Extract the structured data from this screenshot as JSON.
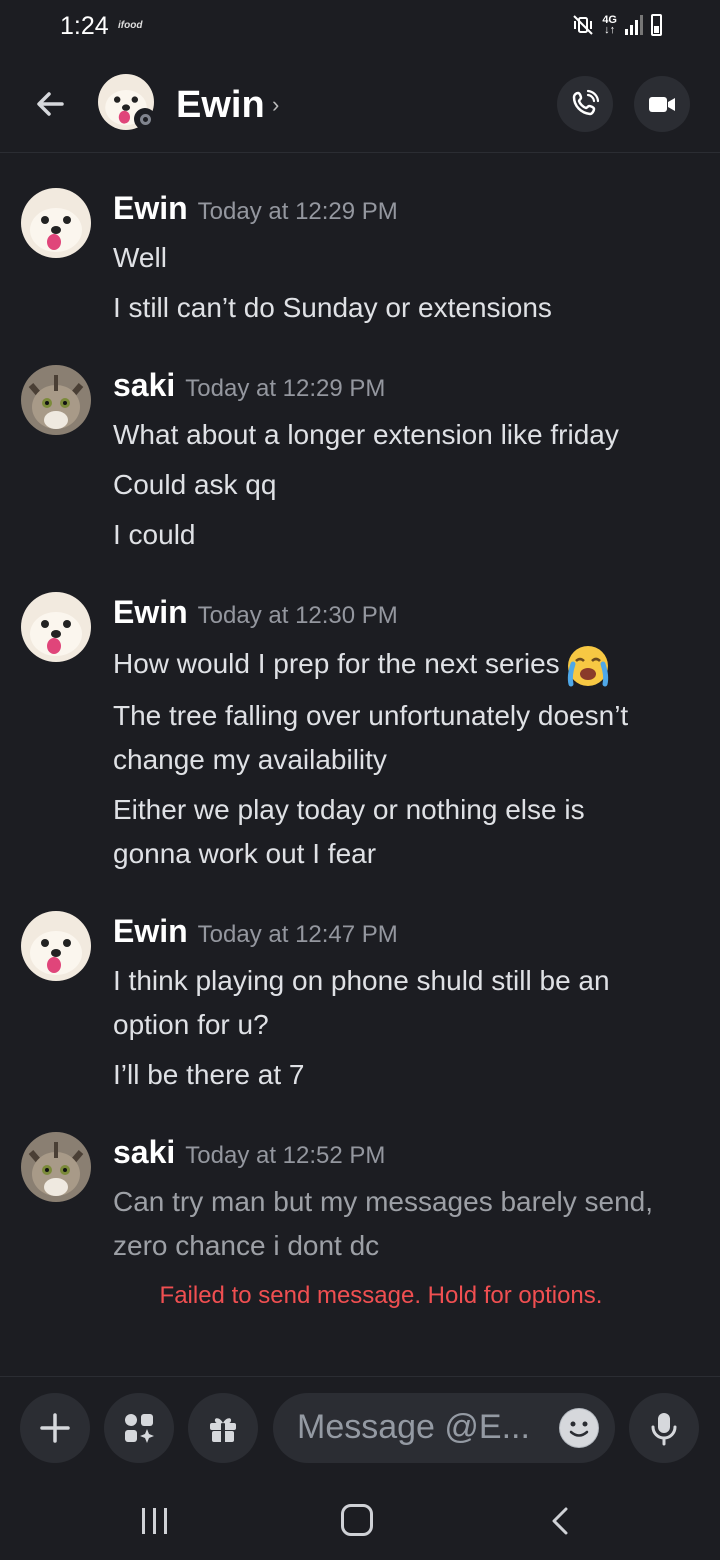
{
  "status_bar": {
    "time": "1:24",
    "carrier": "ifood",
    "network": "4G"
  },
  "header": {
    "name": "Ewin",
    "chevron": "›"
  },
  "messages": [
    {
      "author": "Ewin",
      "timestamp": "Today at 12:29 PM",
      "avatar": "dog",
      "lines": [
        "Well",
        "I still can’t do Sunday or extensions"
      ]
    },
    {
      "author": "saki",
      "timestamp": "Today at 12:29 PM",
      "avatar": "cat",
      "lines": [
        "What about a longer extension like friday",
        "Could ask qq",
        "I could"
      ]
    },
    {
      "author": "Ewin",
      "timestamp": "Today at 12:30 PM",
      "avatar": "dog",
      "lines": [
        "How would I prep for the next series",
        "The tree falling over unfortunately doesn’t",
        "change my availability",
        "Either we play today or nothing else is",
        "gonna work out I fear"
      ],
      "emoji": "loudly-crying-face"
    },
    {
      "author": "Ewin",
      "timestamp": "Today at 12:47 PM",
      "avatar": "dog",
      "lines": [
        "I think playing on phone shuld still be an",
        "option for u?",
        "I’ll be there at 7"
      ]
    },
    {
      "author": "saki",
      "timestamp": "Today at 12:52 PM",
      "avatar": "cat",
      "lines": [
        "Can try man but my messages barely send,",
        "zero chance i dont dc"
      ],
      "pending": true
    }
  ],
  "failed_notice": "Failed to send message. Hold for options.",
  "composer": {
    "placeholder": "Message @E..."
  },
  "colors": {
    "background": "#1c1d22",
    "button": "#2b2d33",
    "error": "#f04f51"
  }
}
